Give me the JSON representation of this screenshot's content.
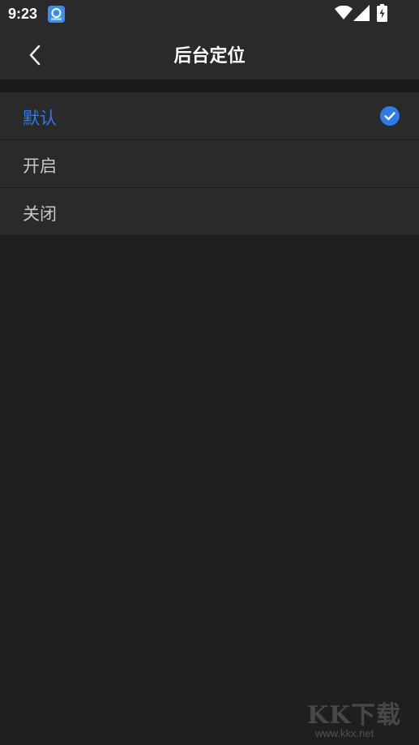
{
  "status_bar": {
    "time": "9:23",
    "icons": [
      "app-notification-icon",
      "wifi-icon",
      "signal-icon",
      "battery-charging-icon"
    ]
  },
  "app_bar": {
    "title": "后台定位",
    "back_icon": "chevron-left-icon"
  },
  "options": [
    {
      "label": "默认",
      "selected": true
    },
    {
      "label": "开启",
      "selected": false
    },
    {
      "label": "关闭",
      "selected": false
    }
  ],
  "colors": {
    "accent": "#2f7be8",
    "background": "#1f1f1f",
    "surface": "#2a2a2a"
  },
  "watermark": {
    "text": "KK下载",
    "url": "www.kkx.net"
  }
}
